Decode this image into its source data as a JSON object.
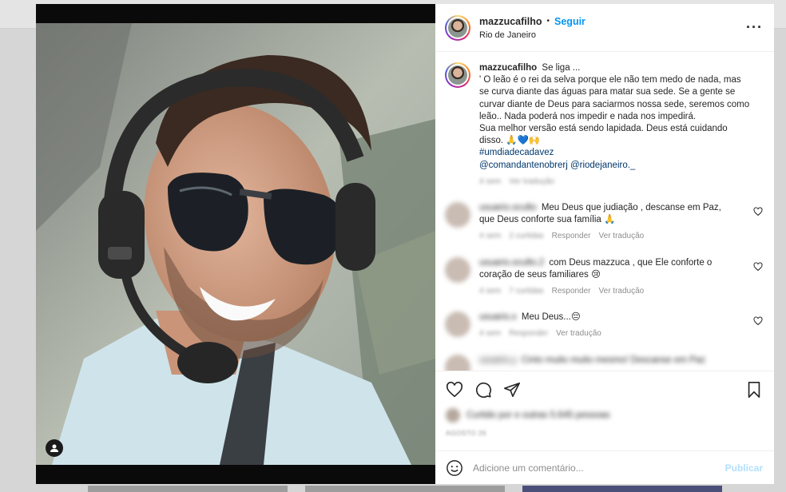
{
  "post": {
    "username": "mazzucafilho",
    "follow_label": "Seguir",
    "location": "Rio de Janeiro",
    "more_icon": "more-horizontal-icon"
  },
  "caption": {
    "username": "mazzucafilho",
    "first_line": "Se liga ...",
    "text": "' O leão é o rei da selva porque ele não tem medo de nada, mas se curva diante das águas para matar sua sede. Se a gente se curvar diante de Deus para saciarmos nossa sede, seremos como leão.. Nada poderá nos impedir e nada nos impedirá.",
    "text2": "Sua melhor versão está sendo lapidada. Deus está cuidando disso. 🙏💙🙌",
    "hashtag": "#umdiadecadavez",
    "mentions": "@comandantenobrerj @riodejaneiro._",
    "time": "4 sem",
    "translate": "Ver tradução"
  },
  "comments": [
    {
      "text": "Meu Deus que judiação , descanse em Paz, que Deus conforte sua família 🙏",
      "time": "4 sem",
      "likes": "2 curtidas",
      "reply": "Responder",
      "translate": "Ver tradução"
    },
    {
      "text": "com Deus mazzuca , que Ele conforte o coração de seus familiares 😢",
      "time": "4 sem",
      "likes": "7 curtidas",
      "reply": "Responder",
      "translate": "Ver tradução"
    },
    {
      "text": "Meu Deus...😔",
      "time": "4 sem",
      "reply": "Responder",
      "translate": "Ver tradução"
    },
    {
      "text": "Cinto muito muito mesmo! Descanse em Paz"
    }
  ],
  "likes_text": "Curtido por e outras 5.645 pessoas",
  "date": "AGOSTO 26",
  "comment_box": {
    "placeholder": "Adicione um comentário...",
    "publish_label": "Publicar"
  },
  "colors": {
    "accent": "#0095f6",
    "publish_disabled": "#b2dffc",
    "hashtag": "#00376b"
  }
}
